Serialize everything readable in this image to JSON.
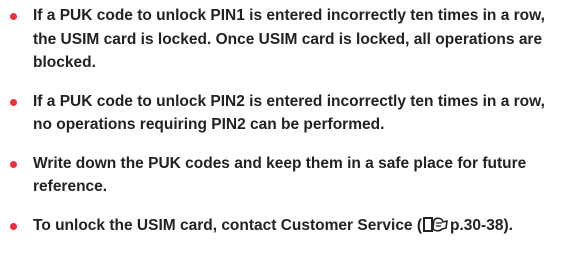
{
  "colors": {
    "bullet": "#e8323c",
    "text": "#222222"
  },
  "bullets": [
    {
      "text": "If a PUK code to unlock PIN1 is entered incorrectly ten times in a row, the USIM card is locked. Once USIM card is locked, all operations are blocked."
    },
    {
      "text": "If a PUK code to unlock PIN2 is entered incorrectly ten times in a row, no operations requiring PIN2 can be performed."
    },
    {
      "text": "Write down the PUK codes and keep them in a safe place for future reference."
    },
    {
      "text_before": "To unlock the USIM card, contact Customer Service (",
      "icon": "page-reference-icon",
      "ref_text": "p.30-38",
      "text_after": ")."
    }
  ]
}
